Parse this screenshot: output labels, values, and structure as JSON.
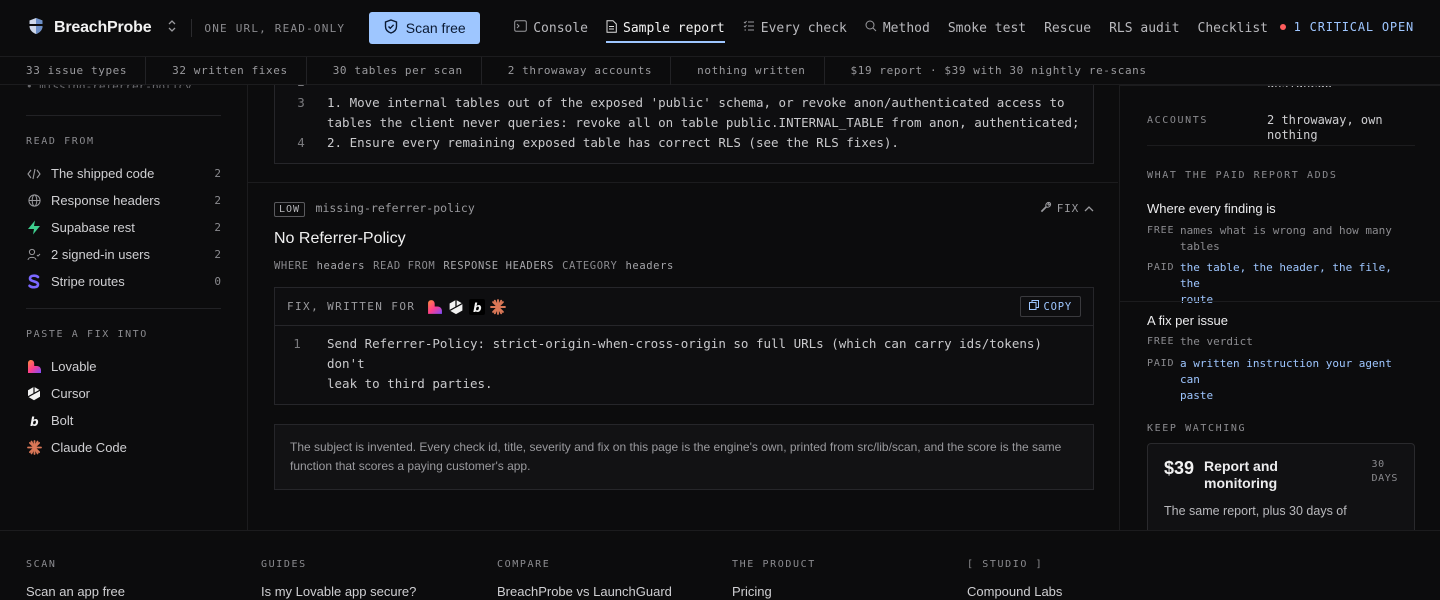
{
  "topbar": {
    "brand": "BreachProbe",
    "tagline": "ONE URL, READ-ONLY",
    "scan_button": "Scan free",
    "nav": [
      {
        "label": "Console",
        "icon": "terminal-icon"
      },
      {
        "label": "Sample report",
        "icon": "document-icon",
        "active": true
      },
      {
        "label": "Every check",
        "icon": "checklist-icon"
      },
      {
        "label": "Method",
        "icon": "search-icon"
      },
      {
        "label": "Smoke test"
      },
      {
        "label": "Rescue"
      },
      {
        "label": "RLS audit"
      },
      {
        "label": "Checklist"
      }
    ],
    "critical": "1 CRITICAL OPEN"
  },
  "stats": [
    "33 issue types",
    "32 written fixes",
    "30 tables per scan",
    "2 throwaway accounts",
    "nothing written",
    "$19 report · $39 with 30 nightly re-scans"
  ],
  "sidebar": {
    "cut_item": "missing-referrer-policy",
    "read_from_heading": "READ FROM",
    "read_from": [
      {
        "label": "The shipped code",
        "count": "2",
        "icon": "code-icon"
      },
      {
        "label": "Response headers",
        "count": "2",
        "icon": "globe-icon"
      },
      {
        "label": "Supabase rest",
        "count": "2",
        "icon": "supabase-icon"
      },
      {
        "label": "2 signed-in users",
        "count": "2",
        "icon": "users-icon"
      },
      {
        "label": "Stripe routes",
        "count": "0",
        "icon": "stripe-icon"
      }
    ],
    "paste_heading": "PASTE A FIX INTO",
    "paste": [
      {
        "label": "Lovable",
        "icon": "lovable-icon"
      },
      {
        "label": "Cursor",
        "icon": "cursor-icon"
      },
      {
        "label": "Bolt",
        "icon": "bolt-icon"
      },
      {
        "label": "Claude Code",
        "icon": "claude-icon"
      }
    ]
  },
  "main": {
    "top_code": [
      {
        "ln": "2",
        "text": ""
      },
      {
        "ln": "3",
        "text": "1. Move internal tables out of the exposed 'public' schema, or revoke anon/authenticated access to"
      },
      {
        "ln": "",
        "text": "tables the client never queries: revoke all on table public.INTERNAL_TABLE from anon, authenticated;"
      },
      {
        "ln": "4",
        "text": "2. Ensure every remaining exposed table has correct RLS (see the RLS fixes)."
      }
    ],
    "finding": {
      "severity": "LOW",
      "id": "missing-referrer-policy",
      "fix_toggle": "FIX",
      "title": "No Referrer-Policy",
      "meta": {
        "where_k": "WHERE",
        "where_v": "headers",
        "read_k": "READ FROM",
        "read_v": "RESPONSE HEADERS",
        "cat_k": "CATEGORY",
        "cat_v": "headers"
      },
      "fix_label": "FIX, WRITTEN FOR",
      "copy": "COPY",
      "fix_lines": [
        {
          "ln": "1",
          "text": "Send Referrer-Policy: strict-origin-when-cross-origin so full URLs (which can carry ids/tokens) don't"
        },
        {
          "ln": "",
          "text": "leak to third parties."
        }
      ]
    },
    "note": "The subject is invented. Every check id, title, severity and fix on this page is the engine's own, printed from src/lib/scan, and the score is the same function that scores a paying customer's app."
  },
  "right": {
    "cut_value": "unsignedo",
    "accounts_k": "ACCOUNTS",
    "accounts_v1": "2 throwaway, own",
    "accounts_v2": "nothing",
    "adds_heading": "WHAT THE PAID REPORT ADDS",
    "where_title": "Where every finding is",
    "where_free_k": "FREE",
    "where_free_1": "names what is wrong and how many",
    "where_free_2": "tables",
    "where_paid_k": "PAID",
    "where_paid_1": "the table, the header, the file, the",
    "where_paid_2": "route",
    "fix_title": "A fix per issue",
    "fix_free_k": "FREE",
    "fix_free": "the verdict",
    "fix_paid_k": "PAID",
    "fix_paid_1": "a written instruction your agent can",
    "fix_paid_2": "paste",
    "watch_heading": "KEEP WATCHING",
    "price": "$39",
    "plan_1": "Report and",
    "plan_2": "monitoring",
    "days_1": "30",
    "days_2": "DAYS",
    "watch_desc": "The same report, plus 30 days of"
  },
  "footer": [
    {
      "heading": "SCAN",
      "link": "Scan an app free"
    },
    {
      "heading": "GUIDES",
      "link": "Is my Lovable app secure?"
    },
    {
      "heading": "COMPARE",
      "link": "BreachProbe vs LaunchGuard"
    },
    {
      "heading": "THE PRODUCT",
      "link": "Pricing"
    },
    {
      "heading": "[ STUDIO ]",
      "link": "Compound Labs"
    }
  ]
}
